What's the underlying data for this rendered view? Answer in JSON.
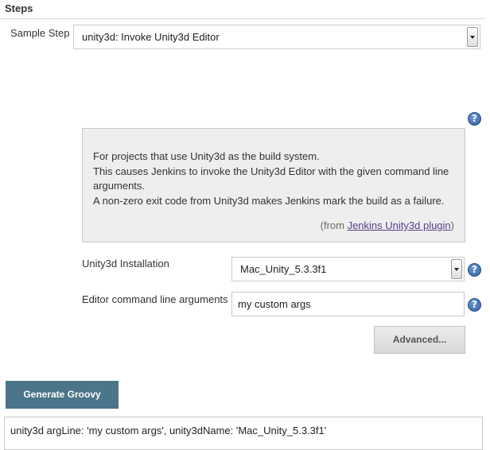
{
  "section": {
    "title": "Steps"
  },
  "sample_step": {
    "label": "Sample Step",
    "selected": "unity3d: Invoke Unity3d Editor"
  },
  "help": {
    "lines": [
      "For projects that use Unity3d as the build system.",
      "This causes Jenkins to invoke the Unity3d Editor with the given command line",
      "arguments.",
      "A non-zero exit code from Unity3d makes Jenkins mark the build as a failure."
    ],
    "from_prefix": "(from ",
    "from_link": "Jenkins Unity3d plugin",
    "from_suffix": ")"
  },
  "installation": {
    "label": "Unity3d Installation",
    "selected": "Mac_Unity_5.3.3f1"
  },
  "editor_args": {
    "label": "Editor command line arguments",
    "value": "my custom args"
  },
  "buttons": {
    "advanced": "Advanced...",
    "generate": "Generate Groovy"
  },
  "output": {
    "value": "unity3d argLine: 'my custom args', unity3dName: 'Mac_Unity_5.3.3f1'"
  },
  "icons": {
    "help": "help-icon",
    "dropdown": "chevron-down-icon"
  },
  "colors": {
    "generate_button": "#4b758b",
    "help_icon": "#2f5f9e",
    "link": "#5a3d8a"
  }
}
